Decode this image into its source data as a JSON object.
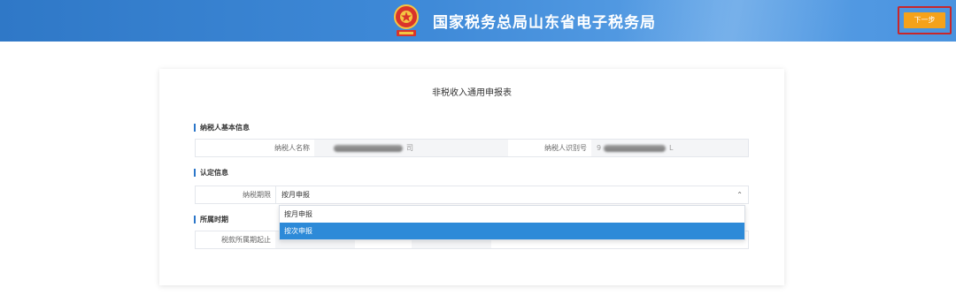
{
  "header": {
    "title": "国家税务总局山东省电子税务局",
    "next_label": "下一步",
    "emblem_icon": "tax-emblem-icon",
    "background": "#3a85d3"
  },
  "form": {
    "title": "非税收入通用申报表",
    "sections": {
      "basic_info": "纳税人基本信息",
      "identification": "认定信息",
      "period": "所属时期"
    },
    "fields": {
      "taxpayer_name_label": "纳税人名称",
      "taxpayer_name_suffix": "司",
      "taxpayer_id_label": "纳税人识别号",
      "taxpayer_id_prefix": "9",
      "taxpayer_id_suffix": "L",
      "filing_period_label": "纳税期限",
      "filing_period_value": "按月申报",
      "tax_period_label": "税款所属期起止"
    },
    "dropdown": {
      "options": [
        "按月申报",
        "按次申报"
      ],
      "highlighted": "按次申报"
    }
  },
  "colors": {
    "accent": "#2d8ad8",
    "next_button": "#f5a21b",
    "highlight_border": "#c8262b"
  }
}
